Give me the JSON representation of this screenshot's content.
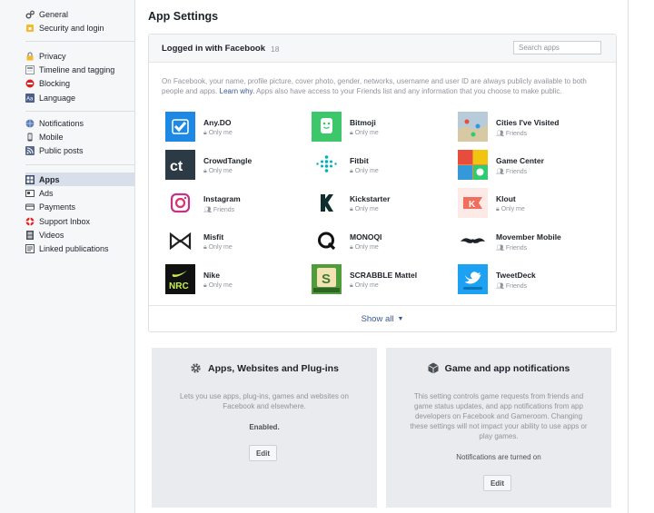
{
  "sidebar": {
    "group1": [
      {
        "label": "General",
        "icon": "gears-icon"
      },
      {
        "label": "Security and login",
        "icon": "shield-lock-icon"
      }
    ],
    "group2": [
      {
        "label": "Privacy",
        "icon": "privacy-lock-icon"
      },
      {
        "label": "Timeline and tagging",
        "icon": "timeline-icon"
      },
      {
        "label": "Blocking",
        "icon": "block-icon"
      },
      {
        "label": "Language",
        "icon": "language-icon"
      }
    ],
    "group3": [
      {
        "label": "Notifications",
        "icon": "globe-icon"
      },
      {
        "label": "Mobile",
        "icon": "mobile-icon"
      },
      {
        "label": "Public posts",
        "icon": "rss-icon"
      }
    ],
    "group4": [
      {
        "label": "Apps",
        "icon": "apps-icon",
        "active": true
      },
      {
        "label": "Ads",
        "icon": "ads-icon"
      },
      {
        "label": "Payments",
        "icon": "card-icon"
      },
      {
        "label": "Support Inbox",
        "icon": "lifebuoy-icon"
      },
      {
        "label": "Videos",
        "icon": "film-icon"
      },
      {
        "label": "Linked publications",
        "icon": "publications-icon"
      }
    ]
  },
  "page": {
    "title": "App Settings"
  },
  "apps_card": {
    "title": "Logged in with Facebook",
    "count": "18",
    "search_placeholder": "Search apps",
    "intro": "On Facebook, your name, profile picture, cover photo, gender, networks, username and user ID are always publicly available to both people and apps.",
    "learn_why": "Learn why.",
    "intro_after": "Apps also have access to your Friends list and any information that you choose to make public.",
    "apps": [
      {
        "name": "Any.DO",
        "visibility": "Only me",
        "color": "#1e88e5"
      },
      {
        "name": "Bitmoji",
        "visibility": "Only me",
        "color": "#3cc86a"
      },
      {
        "name": "Cities I've Visited",
        "visibility": "Friends",
        "color": "#9fb8c9"
      },
      {
        "name": "CrowdTangle",
        "visibility": "Only me",
        "color": "#2c3a46"
      },
      {
        "name": "Fitbit",
        "visibility": "Only me",
        "color": "#ffffff"
      },
      {
        "name": "Game Center",
        "visibility": "Friends",
        "color": "#f0883c"
      },
      {
        "name": "Instagram",
        "visibility": "Friends",
        "color": "#c13584"
      },
      {
        "name": "Kickstarter",
        "visibility": "Only me",
        "color": "#ffffff"
      },
      {
        "name": "Klout",
        "visibility": "Only me",
        "color": "#f26d5b"
      },
      {
        "name": "Misfit",
        "visibility": "Only me",
        "color": "#ffffff"
      },
      {
        "name": "MONOQI",
        "visibility": "Only me",
        "color": "#ffffff"
      },
      {
        "name": "Movember Mobile",
        "visibility": "Friends",
        "color": "#ffffff"
      },
      {
        "name": "Nike",
        "visibility": "Only me",
        "color": "#111111"
      },
      {
        "name": "SCRABBLE Mattel",
        "visibility": "Only me",
        "color": "#3e7d2e"
      },
      {
        "name": "TweetDeck",
        "visibility": "Friends",
        "color": "#1da1f2"
      }
    ],
    "show_all": "Show all"
  },
  "boxes": {
    "apps_sites": {
      "title": "Apps, Websites and Plug-ins",
      "desc": "Lets you use apps, plug-ins, games and websites on Facebook and elsewhere.",
      "status": "Enabled.",
      "edit": "Edit"
    },
    "game_notifications": {
      "title": "Game and app notifications",
      "desc": "This setting controls game requests from friends and game status updates, and app notifications from app developers on Facebook and Gameroom. Changing these settings will not impact your ability to use apps or play games.",
      "status": "Notifications are turned on",
      "edit": "Edit"
    }
  }
}
